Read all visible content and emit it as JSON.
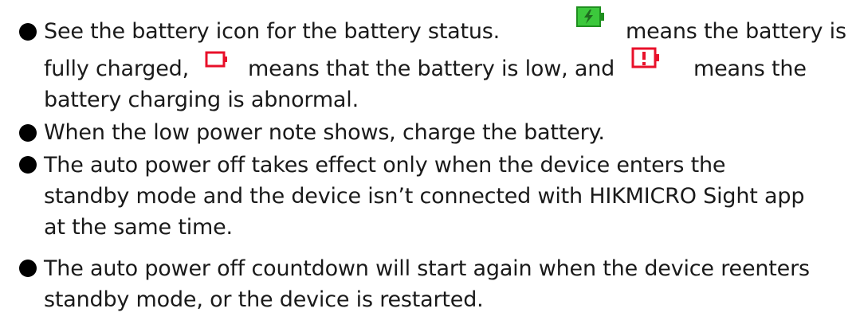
{
  "notes": [
    {
      "segments": [
        "See the battery icon for the battery status.",
        "means the battery is",
        "fully charged,",
        "means that the battery is low, and",
        "means the",
        "battery charging is abnormal."
      ]
    },
    {
      "lines": [
        "When the low power note shows, charge the battery."
      ]
    },
    {
      "lines": [
        "The auto power off takes effect only when the device enters the",
        "standby mode and the device isn’t connected with HIKMICRO Sight app",
        "at the same time."
      ]
    },
    {
      "lines": [
        "The auto power off countdown will start again when the device reenters",
        "standby mode, or the device is restarted."
      ]
    }
  ],
  "icons": {
    "full": {
      "name": "battery-full-icon",
      "color": "#3cc83c",
      "text_color": "#1f6b1f"
    },
    "low": {
      "name": "battery-low-icon",
      "color": "#e8102a"
    },
    "abnormal": {
      "name": "battery-abnormal-icon",
      "color": "#e8102a"
    }
  }
}
